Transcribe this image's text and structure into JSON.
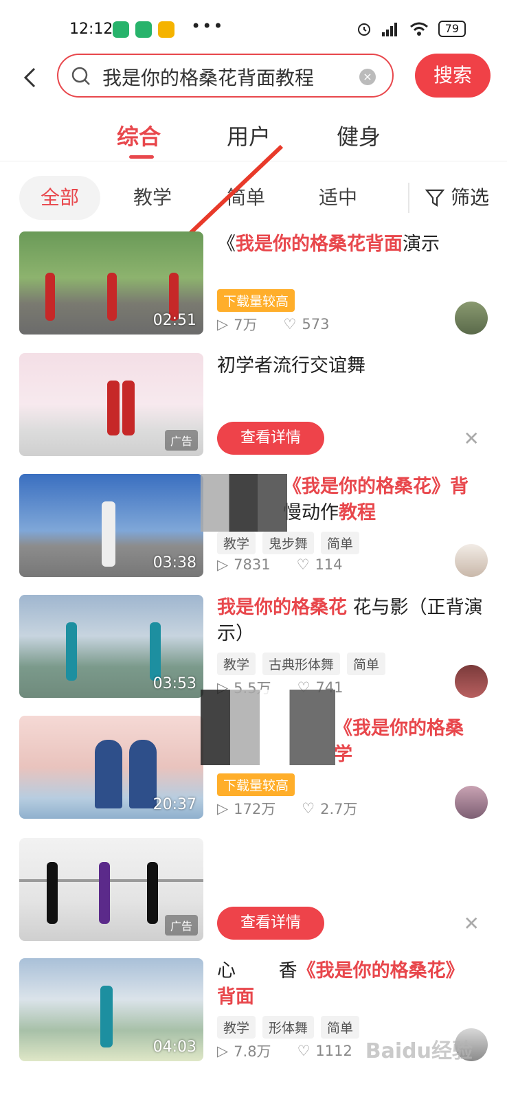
{
  "status_bar": {
    "time": "12:12",
    "dots": "•••",
    "battery": "79"
  },
  "search": {
    "query": "我是你的格桑花背面教程",
    "button": "搜索"
  },
  "tabs": [
    "综合",
    "用户",
    "健身"
  ],
  "filters": {
    "chips": [
      "全部",
      "教学",
      "简单",
      "适中"
    ],
    "filter_label": "筛选"
  },
  "results": [
    {
      "title_pre": "《",
      "title_hl": "我是你的格桑花",
      "title_post": "背面",
      "title_hl2": "",
      "title_post2": "演示",
      "hot_tag": "下载量较高",
      "duration": "02:51",
      "plays": "7万",
      "likes": "573"
    },
    {
      "title": "初学者流行交谊舞",
      "ad_label": "广告",
      "cta": "查看详情"
    },
    {
      "title_hl": "《我是你的格桑花》背",
      "title_plain": "慢动作",
      "title_hl2": "教程",
      "tags": [
        "教学",
        "鬼步舞",
        "简单"
      ],
      "duration": "03:38",
      "plays": "7831",
      "likes": "114"
    },
    {
      "title_hl": "我是你的格桑花",
      "title_plain": " 花与影（正背演示）",
      "tags": [
        "教学",
        "古典形体舞",
        "简单"
      ],
      "duration": "03:53",
      "plays": "5.5万",
      "likes": "741"
    },
    {
      "title_hl": "《我是你的格桑",
      "title_hl2": "学",
      "hot_tag": "下载量较高",
      "duration": "20:37",
      "plays": "172万",
      "likes": "2.7万"
    },
    {
      "ad_label": "广告",
      "cta": "查看详情"
    },
    {
      "title_plain": "心",
      "title_mid": "香",
      "title_hl": "《我是你的格桑花》",
      "title_hl2": "背面",
      "tags": [
        "教学",
        "形体舞",
        "简单"
      ],
      "duration": "04:03",
      "plays": "7.8万",
      "likes": "1112"
    }
  ],
  "watermark": "Baidu经验"
}
